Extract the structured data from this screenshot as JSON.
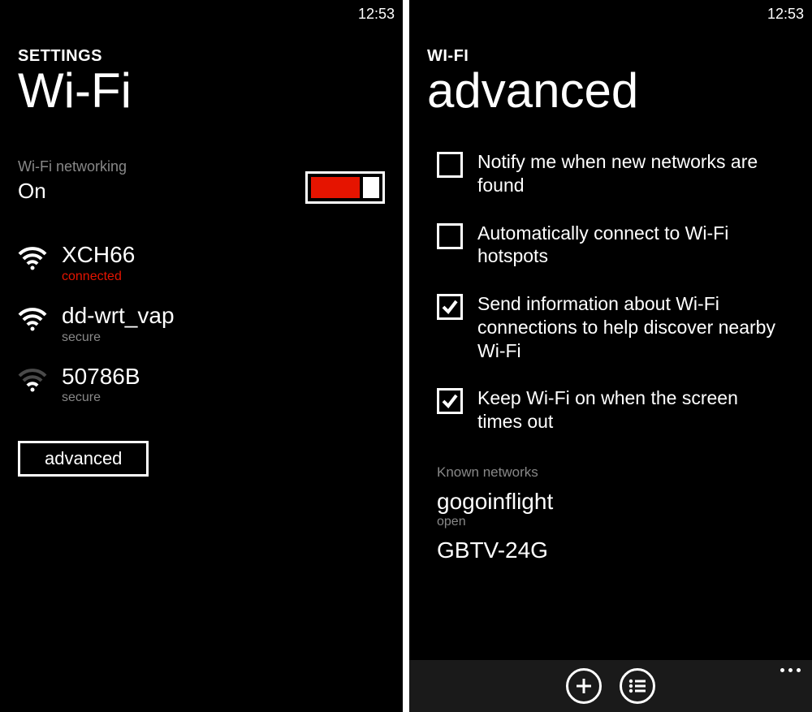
{
  "left": {
    "time": "12:53",
    "header_small": "SETTINGS",
    "header_large": "Wi-Fi",
    "toggle": {
      "caption": "Wi-Fi networking",
      "value": "On",
      "on": true
    },
    "networks": [
      {
        "name": "XCH66",
        "sub": "connected",
        "sub_kind": "connected",
        "strength": "strong"
      },
      {
        "name": "dd-wrt_vap",
        "sub": "secure",
        "sub_kind": "secure",
        "strength": "strong"
      },
      {
        "name": "50786B",
        "sub": "secure",
        "sub_kind": "secure",
        "strength": "weak"
      }
    ],
    "advanced_button": "advanced"
  },
  "right": {
    "time": "12:53",
    "header_small": "WI-FI",
    "header_large": "advanced",
    "options": [
      {
        "label": "Notify me when new networks are found",
        "checked": false
      },
      {
        "label": "Automatically connect to Wi-Fi hotspots",
        "checked": false
      },
      {
        "label": "Send information about Wi-Fi connections to help discover nearby Wi-Fi",
        "checked": true
      },
      {
        "label": "Keep Wi-Fi on when the screen times out",
        "checked": true
      }
    ],
    "known_header": "Known networks",
    "known": [
      {
        "name": "gogoinflight",
        "sub": "open"
      },
      {
        "name": "GBTV-24G",
        "sub": ""
      }
    ],
    "appbar": {
      "add_icon": "plus-icon",
      "select_icon": "list-select-icon",
      "more_icon": "more-dots-icon"
    }
  }
}
